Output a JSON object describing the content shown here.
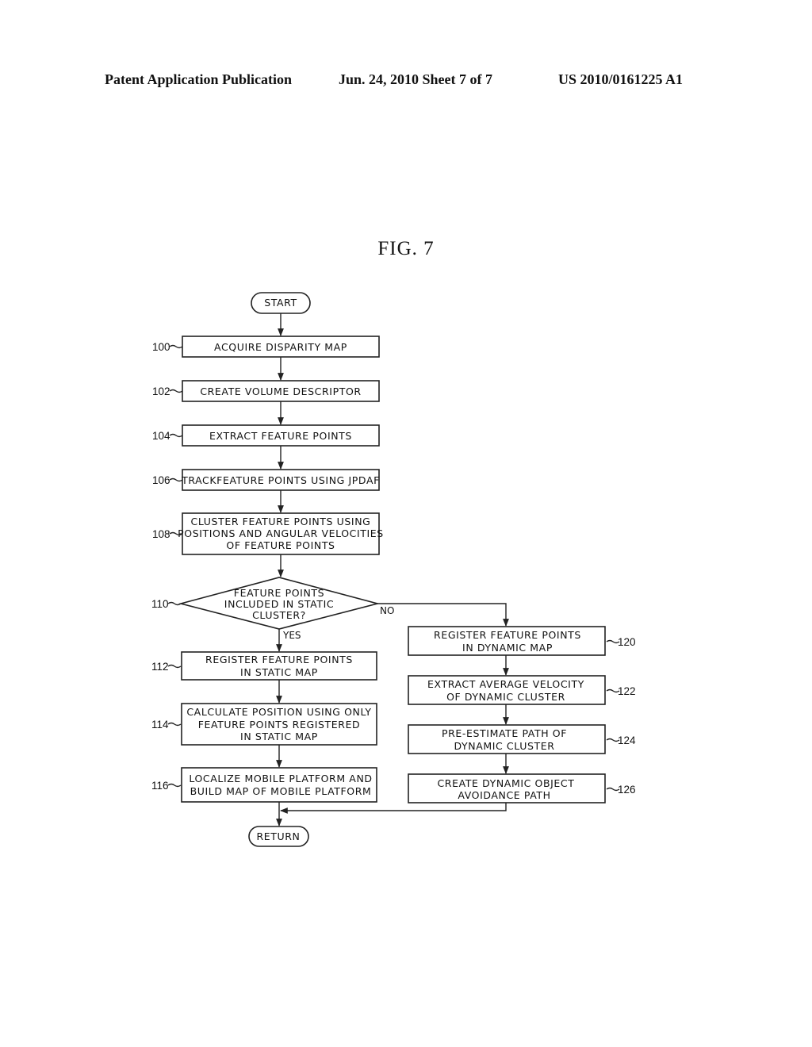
{
  "header": {
    "publication": "Patent Application Publication",
    "date_sheet": "Jun. 24, 2010  Sheet 7 of 7",
    "number": "US 2010/0161225 A1"
  },
  "figure": {
    "title": "FIG. 7"
  },
  "flowchart": {
    "start": "START",
    "return": "RETURN",
    "steps": {
      "s100": {
        "ref": "100",
        "lines": [
          "ACQUIRE DISPARITY MAP"
        ]
      },
      "s102": {
        "ref": "102",
        "lines": [
          "CREATE VOLUME DESCRIPTOR"
        ]
      },
      "s104": {
        "ref": "104",
        "lines": [
          "EXTRACT FEATURE POINTS"
        ]
      },
      "s106": {
        "ref": "106",
        "lines": [
          "TRACKFEATURE POINTS USING JPDAF"
        ]
      },
      "s108": {
        "ref": "108",
        "lines": [
          "CLUSTER FEATURE POINTS USING",
          "POSITIONS AND ANGULAR VELOCITIES",
          "OF FEATURE POINTS"
        ]
      },
      "s110": {
        "ref": "110",
        "lines": [
          "FEATURE POINTS",
          "INCLUDED IN STATIC",
          "CLUSTER?"
        ],
        "yes": "YES",
        "no": "NO"
      },
      "s112": {
        "ref": "112",
        "lines": [
          "REGISTER FEATURE POINTS",
          "IN STATIC MAP"
        ]
      },
      "s114": {
        "ref": "114",
        "lines": [
          "CALCULATE POSITION USING ONLY",
          "FEATURE POINTS REGISTERED",
          "IN STATIC MAP"
        ]
      },
      "s116": {
        "ref": "116",
        "lines": [
          "LOCALIZE MOBILE PLATFORM AND",
          "BUILD MAP OF MOBILE PLATFORM"
        ]
      },
      "s120": {
        "ref": "120",
        "lines": [
          "REGISTER FEATURE POINTS",
          "IN DYNAMIC MAP"
        ]
      },
      "s122": {
        "ref": "122",
        "lines": [
          "EXTRACT AVERAGE VELOCITY",
          "OF DYNAMIC CLUSTER"
        ]
      },
      "s124": {
        "ref": "124",
        "lines": [
          "PRE-ESTIMATE PATH OF",
          "DYNAMIC CLUSTER"
        ]
      },
      "s126": {
        "ref": "126",
        "lines": [
          "CREATE DYNAMIC OBJECT",
          "AVOIDANCE PATH"
        ]
      }
    }
  }
}
